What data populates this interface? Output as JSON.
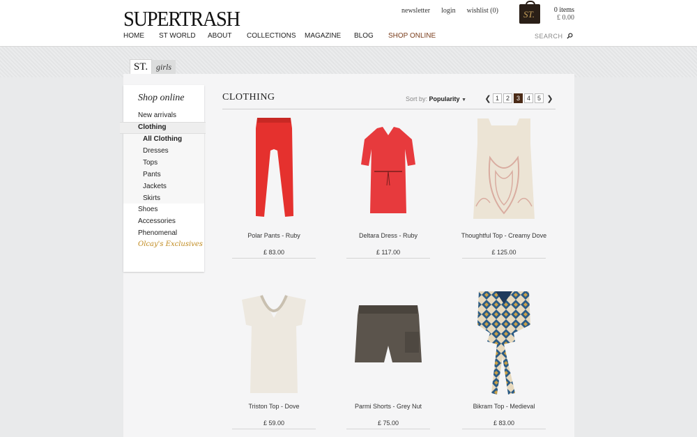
{
  "header": {
    "logo": "SUPERTRASH",
    "links": [
      "newsletter",
      "login",
      "wishlist (0)"
    ],
    "bag_label": "ST.",
    "cart_count": "0 items",
    "cart_total": "£ 0.00",
    "nav": [
      "HOME",
      "ST WORLD",
      "ABOUT",
      "COLLECTIONS",
      "MAGAZINE",
      "BLOG",
      "SHOP ONLINE"
    ],
    "search_placeholder": "SEARCH"
  },
  "tabs": {
    "st": "ST.",
    "girls": "girls"
  },
  "sidebar": {
    "title": "Shop online",
    "items": [
      "New arrivals",
      "Clothing"
    ],
    "sub_items": [
      "All Clothing",
      "Dresses",
      "Tops",
      "Pants",
      "Jackets",
      "Skirts"
    ],
    "more_items": [
      "Shoes",
      "Accessories",
      "Phenomenal"
    ],
    "exclusive": "Olcay's Exclusives"
  },
  "main": {
    "title": "CLOTHING",
    "sort_label": "Sort by:",
    "sort_value": "Popularity",
    "pages": [
      "1",
      "2",
      "3",
      "4",
      "5"
    ],
    "current_page": "3"
  },
  "products": [
    {
      "name": "Polar Pants - Ruby",
      "price": "£ 83.00"
    },
    {
      "name": "Deltara Dress - Ruby",
      "price": "£ 117.00"
    },
    {
      "name": "Thoughtful Top - Creamy Dove",
      "price": "£ 125.00"
    },
    {
      "name": "Triston Top - Dove",
      "price": "£ 59.00"
    },
    {
      "name": "Parmi Shorts - Grey Nut",
      "price": "£ 75.00"
    },
    {
      "name": "Bikram Top - Medieval",
      "price": "£ 83.00"
    }
  ],
  "colors": {
    "accent": "#4b2b17",
    "shop_online": "#7a3d1b",
    "exclusive": "#c08a1e"
  }
}
